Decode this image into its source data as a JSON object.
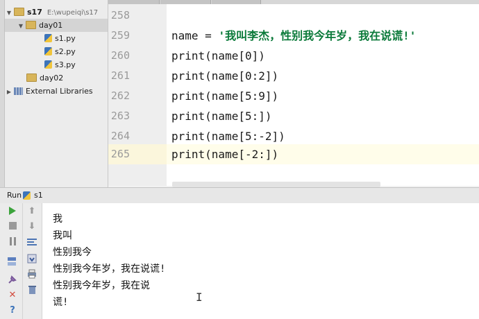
{
  "project": {
    "root": {
      "label": "s17",
      "path": "E:\\wupeiqi\\s17"
    },
    "items": [
      {
        "label": "day01"
      },
      {
        "label": "s1.py"
      },
      {
        "label": "s2.py"
      },
      {
        "label": "s3.py"
      },
      {
        "label": "day02"
      },
      {
        "label": "External Libraries"
      }
    ]
  },
  "editor": {
    "lines": [
      {
        "num": "258",
        "code": ""
      },
      {
        "num": "259",
        "code": "name = ",
        "str": "'我叫李杰，性别我今年岁，我在说谎!'"
      },
      {
        "num": "260",
        "code": "print(name[0])"
      },
      {
        "num": "261",
        "code": "print(name[0:2])"
      },
      {
        "num": "262",
        "code": "print(name[5:9])"
      },
      {
        "num": "263",
        "code": "print(name[5:])"
      },
      {
        "num": "264",
        "code": "print(name[5:-2])"
      },
      {
        "num": "265",
        "code": "print(name[-2:])"
      }
    ]
  },
  "run": {
    "label": "Run",
    "config": "s1"
  },
  "console": {
    "lines": [
      "我",
      "我叫",
      "性别我今",
      "性别我今年岁，我在说谎!",
      "性别我今年岁，我在说",
      "谎!"
    ]
  },
  "icons": {
    "run": "run-icon",
    "stop": "stop-icon",
    "pause": "pause-icon",
    "rerun": "rerun-icon",
    "up": "arrow-up-icon",
    "down": "arrow-down-icon",
    "softwrap": "soft-wrap-icon",
    "scroll": "scroll-to-end-icon",
    "print": "print-icon",
    "trash": "trash-icon",
    "close": "close-icon",
    "help": "help-icon"
  },
  "colors": {
    "string": "#0b7a3a",
    "current_line": "#fffdea",
    "run_green": "#3ba33b",
    "close_red": "#d24b3e"
  }
}
